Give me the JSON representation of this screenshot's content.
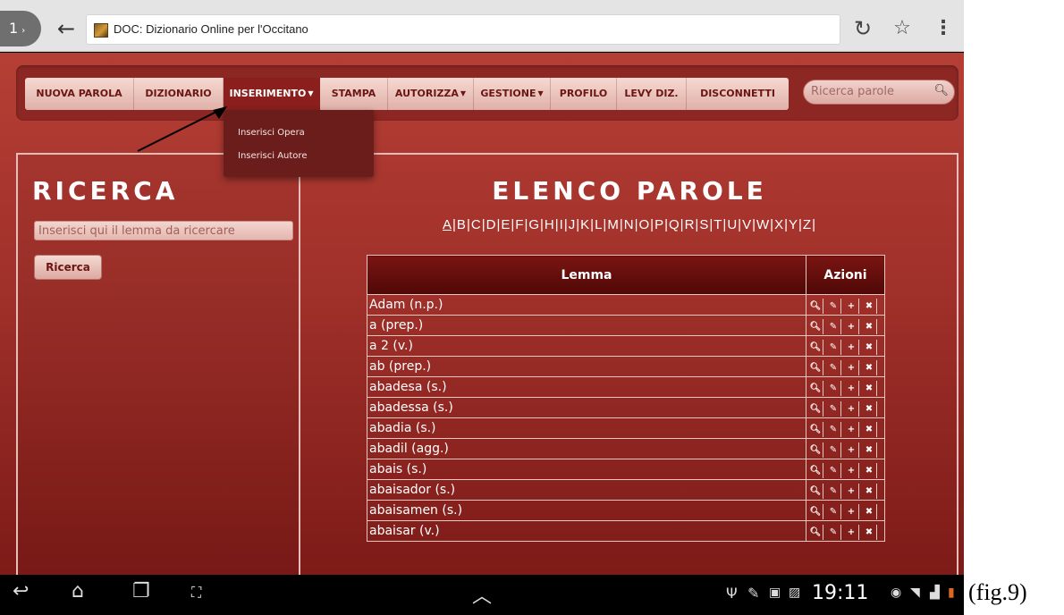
{
  "browser": {
    "tab_count": "1",
    "page_title": "DOC: Dizionario Online per l'Occitano"
  },
  "nav": {
    "items": [
      "NUOVA PAROLA",
      "DIZIONARIO",
      "INSERIMENTO",
      "STAMPA",
      "AUTORIZZA",
      "GESTIONE",
      "PROFILO",
      "LEVY DIZ.",
      "DISCONNETTI"
    ],
    "active": "INSERIMENTO",
    "search_placeholder": "Ricerca parole",
    "dropdown": [
      "Inserisci Opera",
      "Inserisci Autore"
    ]
  },
  "left": {
    "title": "RICERCA",
    "input_placeholder": "Inserisci qui il lemma da ricercare",
    "button_label": "Ricerca"
  },
  "right": {
    "title": "ELENCO PAROLE",
    "letters": [
      "A",
      "B",
      "C",
      "D",
      "E",
      "F",
      "G",
      "H",
      "I",
      "J",
      "K",
      "L",
      "M",
      "N",
      "O",
      "P",
      "Q",
      "R",
      "S",
      "T",
      "U",
      "V",
      "W",
      "X",
      "Y",
      "Z"
    ],
    "col_lemma": "Lemma",
    "col_actions": "Azioni",
    "rows": [
      "Adam (n.p.)",
      "a (prep.)",
      "a 2 (v.)",
      "ab (prep.)",
      "abadesa (s.)",
      "abadessa (s.)",
      "abadia (s.)",
      "abadil (agg.)",
      "abais (s.)",
      "abaisador (s.)",
      "abaisamen (s.)",
      "abaisar (v.)"
    ]
  },
  "system": {
    "clock": "19:11"
  },
  "caption": "(fig.9)",
  "colors": {
    "page_bg": "#a0302a",
    "nav_active": "#8a1f1d",
    "table_header": "#5a0b09"
  }
}
